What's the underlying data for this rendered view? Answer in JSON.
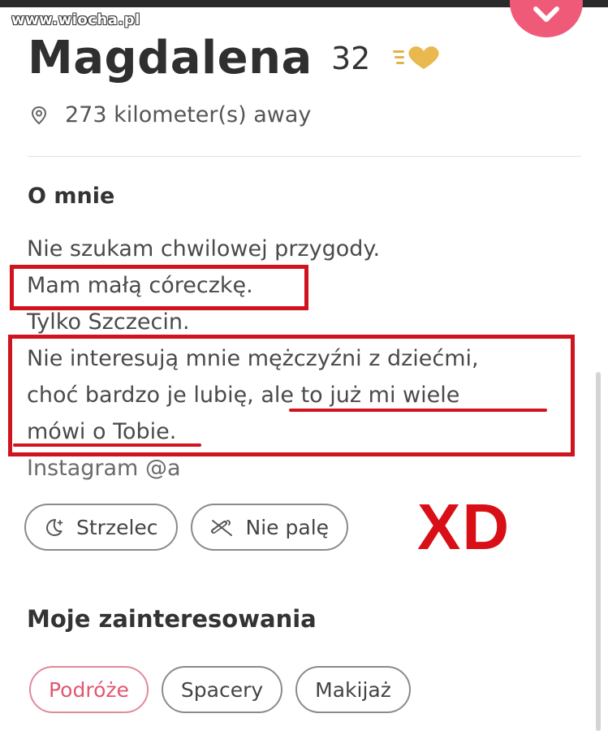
{
  "watermark": "www.wiocha.pl",
  "profile": {
    "name": "Magdalena",
    "age": "32",
    "distance": "273 kilometer(s) away"
  },
  "about": {
    "heading": "O mnie",
    "lines": [
      "Nie szukam chwilowej przygody.",
      "Mam małą córeczkę.",
      "Tylko Szczecin.",
      "Nie interesują mnie mężczyźni z dziećmi,",
      "choć bardzo je lubię, ale to już mi wiele",
      "mówi o Tobie.",
      "Instagram @a"
    ]
  },
  "tags": [
    {
      "label": "Strzelec",
      "icon": "moon-sparkle-icon"
    },
    {
      "label": "Nie palę",
      "icon": "no-smoking-icon"
    }
  ],
  "annotation": "XD",
  "interests": {
    "heading": "Moje zainteresowania",
    "items": [
      "Podróże",
      "Spacery",
      "Makijaż"
    ]
  },
  "colors": {
    "like_button": "#ef5a78",
    "highlight_red": "#d0141f",
    "interest_accent": "#e0576f"
  }
}
